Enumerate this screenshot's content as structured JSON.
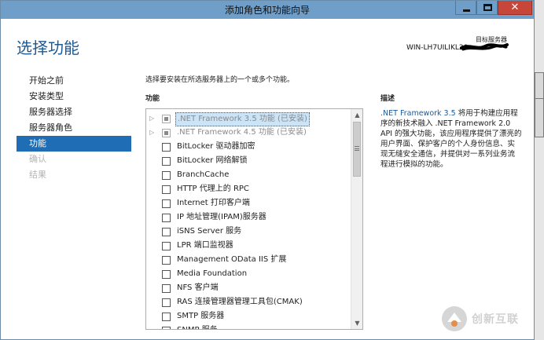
{
  "window": {
    "title": "添加角色和功能向导"
  },
  "header": {
    "page_title": "选择功能",
    "target_label": "目标服务器",
    "target_value": "WIN-LH7UILIKL20"
  },
  "nav": {
    "items": [
      {
        "label": "开始之前",
        "state": "normal"
      },
      {
        "label": "安装类型",
        "state": "normal"
      },
      {
        "label": "服务器选择",
        "state": "normal"
      },
      {
        "label": "服务器角色",
        "state": "normal"
      },
      {
        "label": "功能",
        "state": "active"
      },
      {
        "label": "确认",
        "state": "disabled"
      },
      {
        "label": "结果",
        "state": "disabled"
      }
    ]
  },
  "main": {
    "instruction": "选择要安装在所选服务器上的一个或多个功能。",
    "features_heading": "功能",
    "description_heading": "描述",
    "features": [
      {
        "label": ".NET Framework 3.5 功能 (已安装)",
        "expandable": true,
        "check": "partial",
        "selected": true,
        "grey": true
      },
      {
        "label": ".NET Framework 4.5 功能 (已安装)",
        "expandable": true,
        "check": "partial",
        "selected": false,
        "grey": true
      },
      {
        "label": "BitLocker 驱动器加密"
      },
      {
        "label": "BitLocker 网络解锁"
      },
      {
        "label": "BranchCache"
      },
      {
        "label": "HTTP 代理上的 RPC"
      },
      {
        "label": "Internet 打印客户端"
      },
      {
        "label": "IP 地址管理(IPAM)服务器"
      },
      {
        "label": "iSNS Server 服务"
      },
      {
        "label": "LPR 端口监视器"
      },
      {
        "label": "Management OData IIS 扩展"
      },
      {
        "label": "Media Foundation"
      },
      {
        "label": "NFS 客户端"
      },
      {
        "label": "RAS 连接管理器管理工具包(CMAK)"
      },
      {
        "label": "SMTP 服务器"
      },
      {
        "label": "SNMP 服务"
      }
    ],
    "description": {
      "highlight": ".NET Framework 3.5",
      "text": " 将用于构建应用程序的新技术融入 .NET Framework 2.0 API 的强大功能，该应用程序提供了漂亮的用户界面、保护客户的个人身份信息、实现无缝安全通信，并提供对一系列业务流程进行模拟的功能。"
    }
  },
  "watermark": {
    "text": "创新互联"
  },
  "colors": {
    "titlebar": "#6f9fc9",
    "accent": "#1f6eb5",
    "title_text": "#1c5a96",
    "close_button": "#c7463a"
  }
}
